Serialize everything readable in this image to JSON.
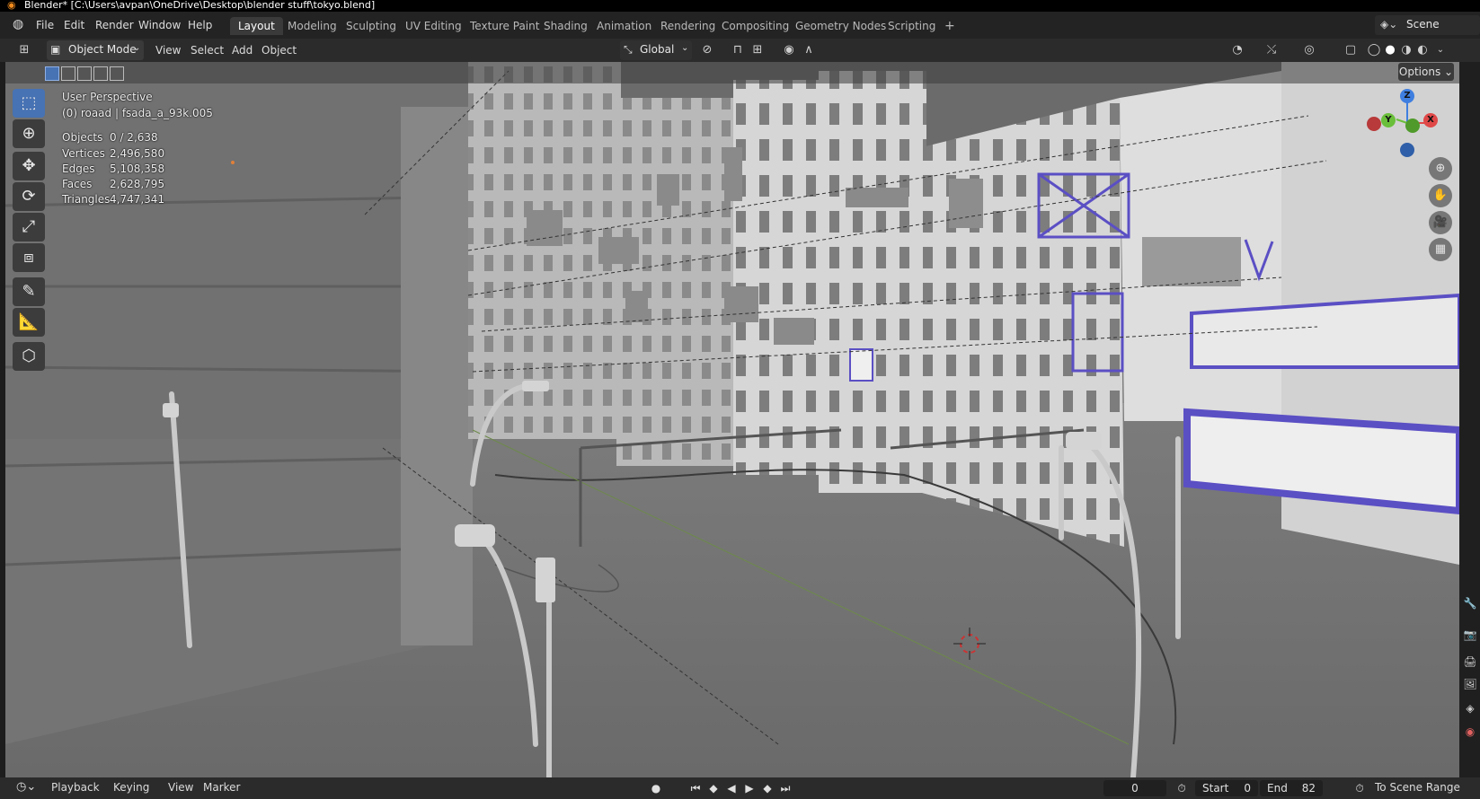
{
  "window": {
    "title": "Blender* [C:\\Users\\avpan\\OneDrive\\Desktop\\blender stuff\\tokyo.blend]"
  },
  "menu": {
    "items": [
      "File",
      "Edit",
      "Render",
      "Window",
      "Help"
    ]
  },
  "workspaces": {
    "tabs": [
      "Layout",
      "Modeling",
      "Sculpting",
      "UV Editing",
      "Texture Paint",
      "Shading",
      "Animation",
      "Rendering",
      "Compositing",
      "Geometry Nodes",
      "Scripting"
    ],
    "active": "Layout",
    "add_symbol": "+"
  },
  "scene": {
    "label": "Scene"
  },
  "header": {
    "mode": "Object Mode",
    "menus": [
      "View",
      "Select",
      "Add",
      "Object"
    ],
    "transform_orientation": "Global"
  },
  "viewport": {
    "options_label": "Options",
    "perspective": "User Perspective",
    "active_object": "(0) roaad | fsada_a_93k.005",
    "stats": [
      {
        "label": "Objects",
        "value": "0 / 2,638"
      },
      {
        "label": "Vertices",
        "value": "2,496,580"
      },
      {
        "label": "Edges",
        "value": "5,108,358"
      },
      {
        "label": "Faces",
        "value": "2,628,795"
      },
      {
        "label": "Triangles",
        "value": "4,747,341"
      }
    ],
    "gizmo": {
      "z": "Z",
      "y": "Y",
      "x": "X"
    },
    "accent": "#4772b3",
    "sign_outline_color": "#5b4fc4"
  },
  "tools": [
    "select-box-icon",
    "cursor-icon",
    "move-icon",
    "rotate-icon",
    "scale-icon",
    "transform-icon",
    "annotate-icon",
    "measure-icon",
    "add-cube-icon"
  ],
  "timeline": {
    "menus": [
      "Playback",
      "Keying",
      "View",
      "Marker"
    ],
    "current_frame": "0",
    "start_label": "Start",
    "start_value": "0",
    "end_label": "End",
    "end_value": "82",
    "scene_range_label": "To Scene Range"
  }
}
